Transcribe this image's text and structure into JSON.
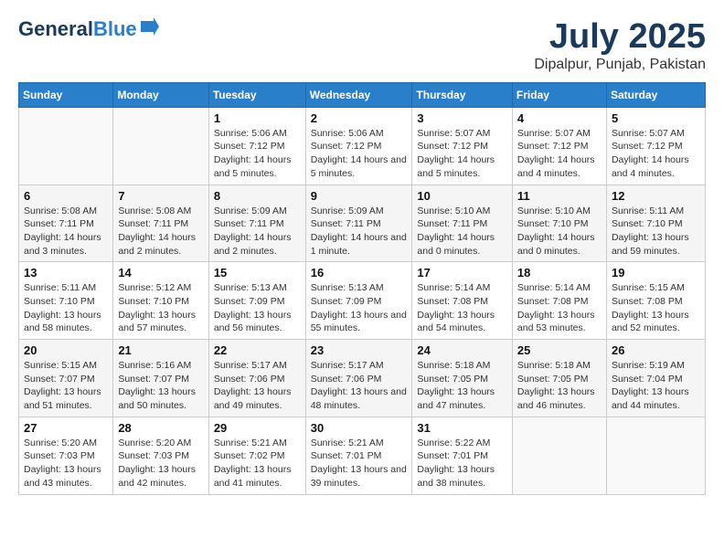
{
  "logo": {
    "line1": "General",
    "line2": "Blue"
  },
  "title": "July 2025",
  "subtitle": "Dipalpur, Punjab, Pakistan",
  "headers": [
    "Sunday",
    "Monday",
    "Tuesday",
    "Wednesday",
    "Thursday",
    "Friday",
    "Saturday"
  ],
  "weeks": [
    [
      {
        "day": "",
        "info": ""
      },
      {
        "day": "",
        "info": ""
      },
      {
        "day": "1",
        "info": "Sunrise: 5:06 AM\nSunset: 7:12 PM\nDaylight: 14 hours and 5 minutes."
      },
      {
        "day": "2",
        "info": "Sunrise: 5:06 AM\nSunset: 7:12 PM\nDaylight: 14 hours and 5 minutes."
      },
      {
        "day": "3",
        "info": "Sunrise: 5:07 AM\nSunset: 7:12 PM\nDaylight: 14 hours and 5 minutes."
      },
      {
        "day": "4",
        "info": "Sunrise: 5:07 AM\nSunset: 7:12 PM\nDaylight: 14 hours and 4 minutes."
      },
      {
        "day": "5",
        "info": "Sunrise: 5:07 AM\nSunset: 7:12 PM\nDaylight: 14 hours and 4 minutes."
      }
    ],
    [
      {
        "day": "6",
        "info": "Sunrise: 5:08 AM\nSunset: 7:11 PM\nDaylight: 14 hours and 3 minutes."
      },
      {
        "day": "7",
        "info": "Sunrise: 5:08 AM\nSunset: 7:11 PM\nDaylight: 14 hours and 2 minutes."
      },
      {
        "day": "8",
        "info": "Sunrise: 5:09 AM\nSunset: 7:11 PM\nDaylight: 14 hours and 2 minutes."
      },
      {
        "day": "9",
        "info": "Sunrise: 5:09 AM\nSunset: 7:11 PM\nDaylight: 14 hours and 1 minute."
      },
      {
        "day": "10",
        "info": "Sunrise: 5:10 AM\nSunset: 7:11 PM\nDaylight: 14 hours and 0 minutes."
      },
      {
        "day": "11",
        "info": "Sunrise: 5:10 AM\nSunset: 7:10 PM\nDaylight: 14 hours and 0 minutes."
      },
      {
        "day": "12",
        "info": "Sunrise: 5:11 AM\nSunset: 7:10 PM\nDaylight: 13 hours and 59 minutes."
      }
    ],
    [
      {
        "day": "13",
        "info": "Sunrise: 5:11 AM\nSunset: 7:10 PM\nDaylight: 13 hours and 58 minutes."
      },
      {
        "day": "14",
        "info": "Sunrise: 5:12 AM\nSunset: 7:10 PM\nDaylight: 13 hours and 57 minutes."
      },
      {
        "day": "15",
        "info": "Sunrise: 5:13 AM\nSunset: 7:09 PM\nDaylight: 13 hours and 56 minutes."
      },
      {
        "day": "16",
        "info": "Sunrise: 5:13 AM\nSunset: 7:09 PM\nDaylight: 13 hours and 55 minutes."
      },
      {
        "day": "17",
        "info": "Sunrise: 5:14 AM\nSunset: 7:08 PM\nDaylight: 13 hours and 54 minutes."
      },
      {
        "day": "18",
        "info": "Sunrise: 5:14 AM\nSunset: 7:08 PM\nDaylight: 13 hours and 53 minutes."
      },
      {
        "day": "19",
        "info": "Sunrise: 5:15 AM\nSunset: 7:08 PM\nDaylight: 13 hours and 52 minutes."
      }
    ],
    [
      {
        "day": "20",
        "info": "Sunrise: 5:15 AM\nSunset: 7:07 PM\nDaylight: 13 hours and 51 minutes."
      },
      {
        "day": "21",
        "info": "Sunrise: 5:16 AM\nSunset: 7:07 PM\nDaylight: 13 hours and 50 minutes."
      },
      {
        "day": "22",
        "info": "Sunrise: 5:17 AM\nSunset: 7:06 PM\nDaylight: 13 hours and 49 minutes."
      },
      {
        "day": "23",
        "info": "Sunrise: 5:17 AM\nSunset: 7:06 PM\nDaylight: 13 hours and 48 minutes."
      },
      {
        "day": "24",
        "info": "Sunrise: 5:18 AM\nSunset: 7:05 PM\nDaylight: 13 hours and 47 minutes."
      },
      {
        "day": "25",
        "info": "Sunrise: 5:18 AM\nSunset: 7:05 PM\nDaylight: 13 hours and 46 minutes."
      },
      {
        "day": "26",
        "info": "Sunrise: 5:19 AM\nSunset: 7:04 PM\nDaylight: 13 hours and 44 minutes."
      }
    ],
    [
      {
        "day": "27",
        "info": "Sunrise: 5:20 AM\nSunset: 7:03 PM\nDaylight: 13 hours and 43 minutes."
      },
      {
        "day": "28",
        "info": "Sunrise: 5:20 AM\nSunset: 7:03 PM\nDaylight: 13 hours and 42 minutes."
      },
      {
        "day": "29",
        "info": "Sunrise: 5:21 AM\nSunset: 7:02 PM\nDaylight: 13 hours and 41 minutes."
      },
      {
        "day": "30",
        "info": "Sunrise: 5:21 AM\nSunset: 7:01 PM\nDaylight: 13 hours and 39 minutes."
      },
      {
        "day": "31",
        "info": "Sunrise: 5:22 AM\nSunset: 7:01 PM\nDaylight: 13 hours and 38 minutes."
      },
      {
        "day": "",
        "info": ""
      },
      {
        "day": "",
        "info": ""
      }
    ]
  ]
}
